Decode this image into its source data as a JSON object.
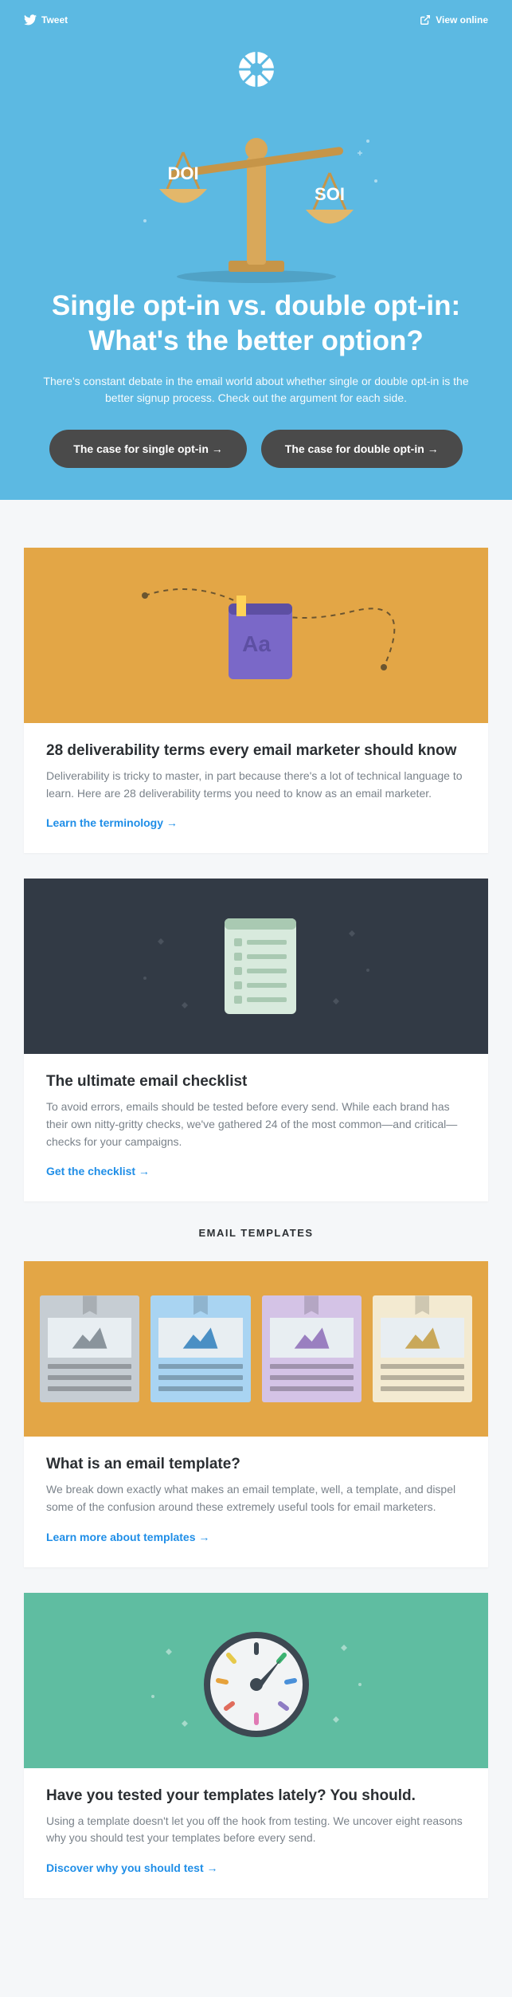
{
  "topbar": {
    "tweet": "Tweet",
    "view_online": "View online"
  },
  "hero": {
    "scale_left": "DOI",
    "scale_right": "SOI",
    "title": "Single opt-in vs. double opt-in: What's the better option?",
    "subtitle": "There's constant debate in the email world about whether single or double opt-in is the better signup process. Check out the argument for each side.",
    "btn_single": "The case for single opt-in",
    "btn_double": "The case for double opt-in"
  },
  "cards": {
    "deliverability": {
      "title": "28 deliverability terms every email marketer should know",
      "text": "Deliverability is tricky to master, in part because there's a lot of technical language to learn. Here are 28 deliverability terms you need to know as an email marketer.",
      "link": "Learn the terminology"
    },
    "checklist": {
      "title": "The ultimate email checklist",
      "text": "To avoid errors, emails should be tested before every send. While each brand has their own nitty-gritty checks, we've gathered 24 of the most common—and critical—checks for your campaigns.",
      "link": "Get the checklist"
    },
    "template": {
      "title": "What is an email template?",
      "text": "We break down exactly what makes an email template, well, a template, and dispel some of the confusion around these extremely useful tools for email marketers.",
      "link": "Learn more about templates"
    },
    "testing": {
      "title": "Have you tested your templates lately? You should.",
      "text": "Using a template doesn't let you off the hook from testing. We uncover eight reasons why you should test your templates before every send.",
      "link": "Discover why you should test"
    }
  },
  "section_label": "EMAIL TEMPLATES"
}
